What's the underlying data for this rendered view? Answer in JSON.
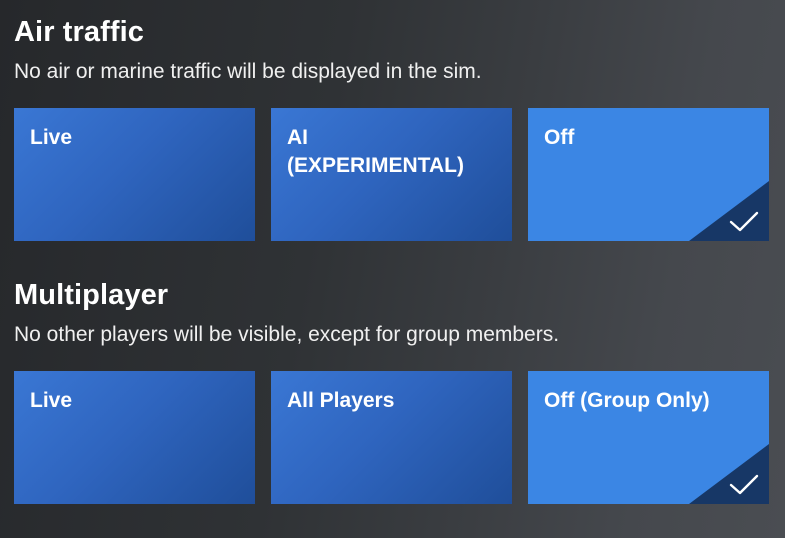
{
  "air_traffic": {
    "title": "Air traffic",
    "description": "No air or marine traffic will be displayed in the sim.",
    "options": [
      {
        "label": "Live",
        "selected": false
      },
      {
        "label": "AI\n(EXPERIMENTAL)",
        "selected": false
      },
      {
        "label": "Off",
        "selected": true
      }
    ]
  },
  "multiplayer": {
    "title": "Multiplayer",
    "description": "No other players will be visible, except for group members.",
    "options": [
      {
        "label": "Live",
        "selected": false
      },
      {
        "label": "All Players",
        "selected": false
      },
      {
        "label": "Off (Group Only)",
        "selected": true
      }
    ]
  },
  "icons": {
    "selected_marker": "checkmark-icon"
  },
  "colors": {
    "tile_blue": "#2f65bf",
    "tile_selected": "#3b86e4",
    "check_corner": "#173766"
  }
}
